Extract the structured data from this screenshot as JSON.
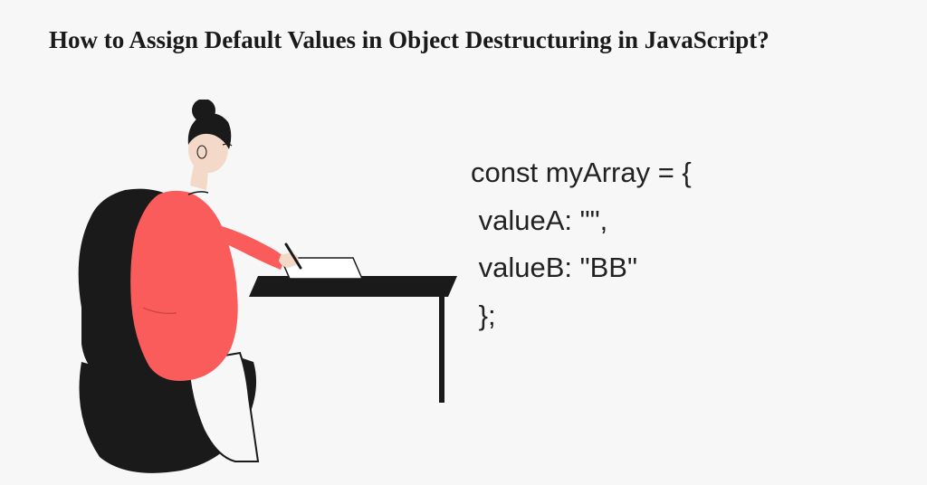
{
  "title": "How to Assign Default Values in Object Destructuring in JavaScript?",
  "code": {
    "line1": "const myArray = {",
    "line2": " valueA: \"\",",
    "line3": " valueB: \"BB\"",
    "line4": " };"
  }
}
